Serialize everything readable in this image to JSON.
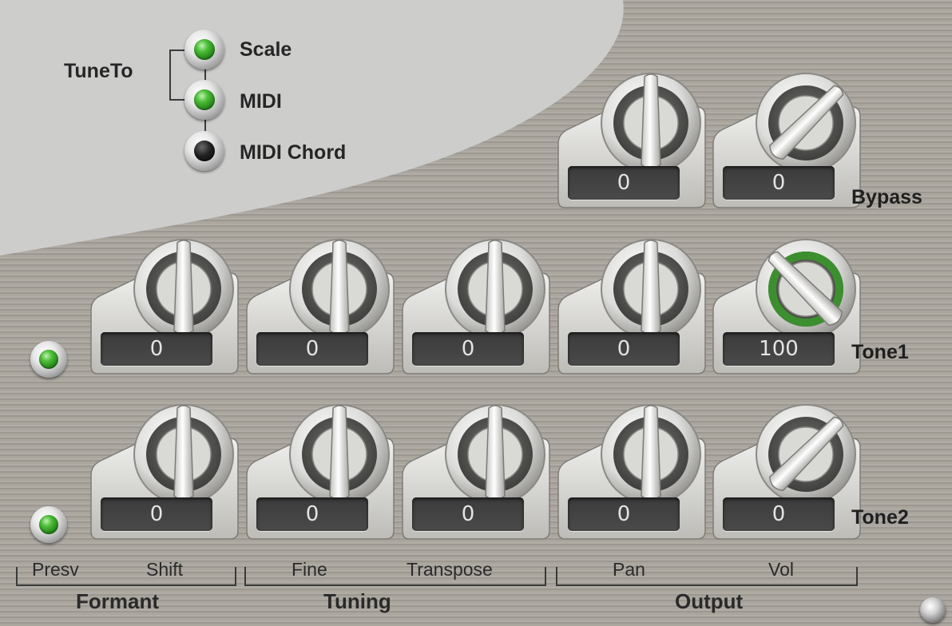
{
  "tune_to": {
    "label": "TuneTo",
    "options": [
      {
        "label": "Scale",
        "led": "on"
      },
      {
        "label": "MIDI",
        "led": "on"
      },
      {
        "label": "MIDI Chord",
        "led": "off"
      }
    ]
  },
  "rows": {
    "bypass": {
      "label": "Bypass",
      "knobs": [
        {
          "param": "pan",
          "value": "0",
          "pointer_deg": 0,
          "ring": "none"
        },
        {
          "param": "vol",
          "value": "0",
          "pointer_deg": 45,
          "ring": "none"
        }
      ]
    },
    "tone1": {
      "label": "Tone1",
      "led": "on",
      "knobs": [
        {
          "param": "formant-shift",
          "value": "0",
          "pointer_deg": 0,
          "ring": "none"
        },
        {
          "param": "fine",
          "value": "0",
          "pointer_deg": 0,
          "ring": "none"
        },
        {
          "param": "transpose",
          "value": "0",
          "pointer_deg": 0,
          "ring": "none"
        },
        {
          "param": "pan",
          "value": "0",
          "pointer_deg": 0,
          "ring": "none"
        },
        {
          "param": "vol",
          "value": "100",
          "pointer_deg": -45,
          "ring": "full"
        }
      ]
    },
    "tone2": {
      "label": "Tone2",
      "led": "on",
      "knobs": [
        {
          "param": "formant-shift",
          "value": "0",
          "pointer_deg": 0,
          "ring": "none"
        },
        {
          "param": "fine",
          "value": "0",
          "pointer_deg": 0,
          "ring": "none"
        },
        {
          "param": "transpose",
          "value": "0",
          "pointer_deg": 0,
          "ring": "none"
        },
        {
          "param": "pan",
          "value": "0",
          "pointer_deg": 0,
          "ring": "none"
        },
        {
          "param": "vol",
          "value": "0",
          "pointer_deg": 45,
          "ring": "none"
        }
      ]
    }
  },
  "column_labels": {
    "presv": "Presv",
    "shift": "Shift",
    "fine": "Fine",
    "transpose": "Transpose",
    "pan": "Pan",
    "vol": "Vol"
  },
  "groups": {
    "formant": "Formant",
    "tuning": "Tuning",
    "output": "Output"
  },
  "colors": {
    "panel": "#a8a49c",
    "swoosh": "#cfcfcf",
    "led_on": "#3fae2e",
    "led_off": "#111111",
    "value_ring": "#3c8f2e",
    "display_bg": "#404040",
    "display_text": "#e4e4e4"
  }
}
